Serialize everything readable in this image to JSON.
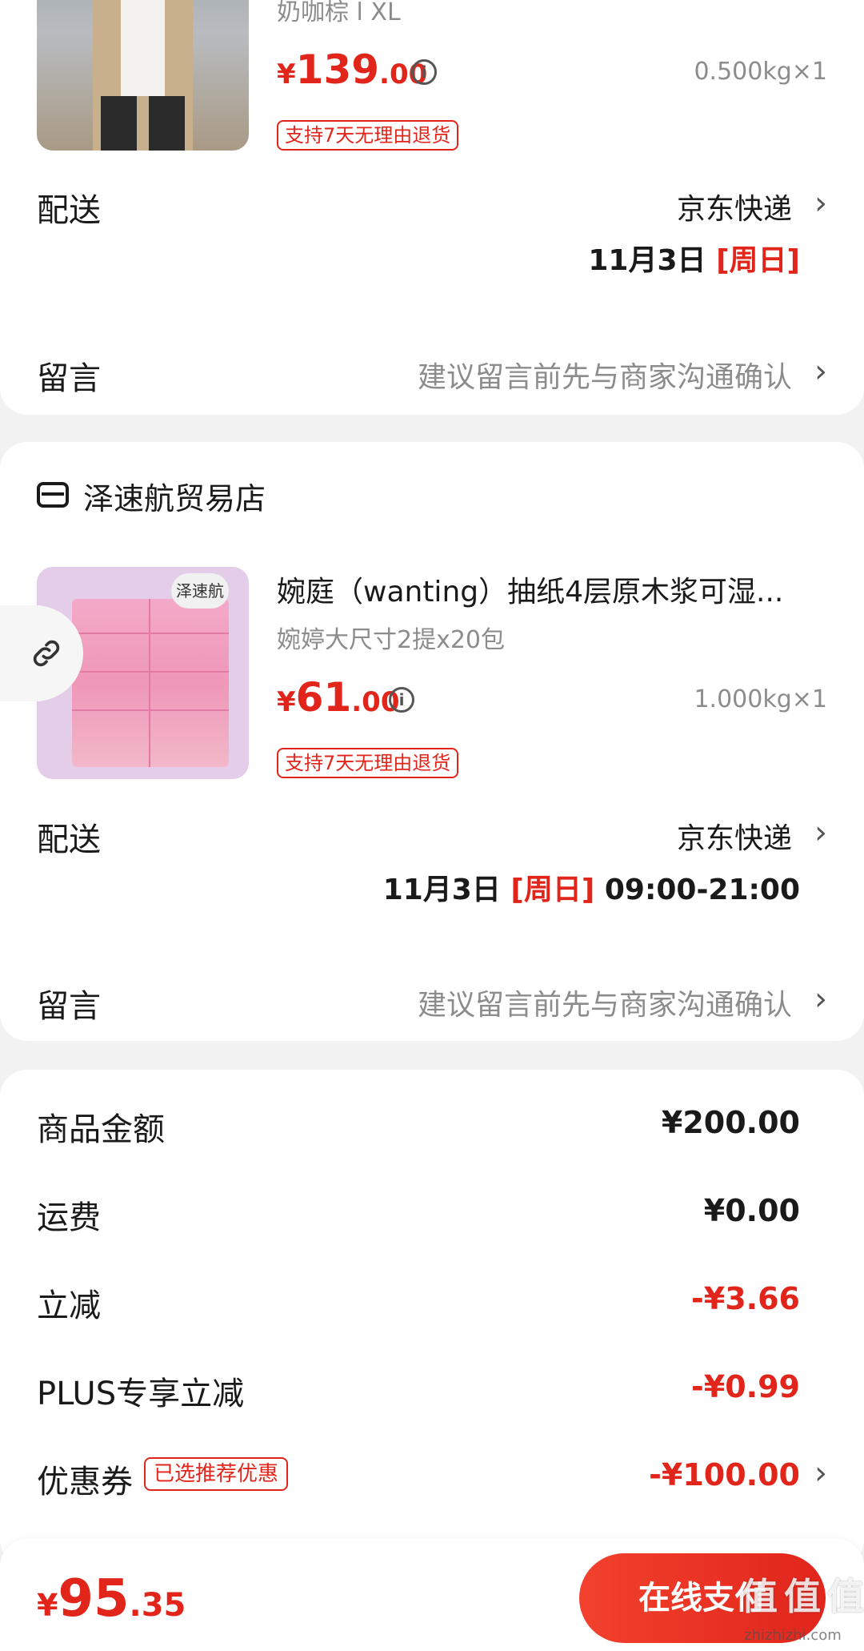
{
  "colors": {
    "accent": "#e1251b",
    "background": "#f2f2f2"
  },
  "item1": {
    "variant": "奶咖棕 l XL",
    "price_currency": "¥",
    "price_int": "139",
    "price_dec": ".00",
    "weight": "0.500kg×1",
    "return_tag": "支持7天无理由退货",
    "delivery_label": "配送",
    "delivery_carrier": "京东快递",
    "delivery_date": "11月3日",
    "delivery_weekday": "[周日]",
    "message_label": "留言",
    "message_placeholder": "建议留言前先与商家沟通确认"
  },
  "shop2": {
    "name": "泽速航贸易店",
    "icon": "store-icon",
    "product_title": "婉庭（wanting）抽纸4层原木浆可湿...",
    "variant": "婉婷大尺寸2提x20包",
    "price_currency": "¥",
    "price_int": "61",
    "price_dec": ".00",
    "weight": "1.000kg×1",
    "return_tag": "支持7天无理由退货",
    "delivery_label": "配送",
    "delivery_carrier": "京东快递",
    "delivery_date": "11月3日",
    "delivery_weekday": "[周日]",
    "delivery_time": "09:00-21:00",
    "message_label": "留言",
    "message_placeholder": "建议留言前先与商家沟通确认",
    "product_image_text": "泽速航"
  },
  "summary": {
    "goods_label": "商品金额",
    "goods_value": "¥200.00",
    "shipping_label": "运费",
    "shipping_value": "¥0.00",
    "discount_label": "立减",
    "discount_value": "-¥3.66",
    "plus_label": "PLUS专享立减",
    "plus_value": "-¥0.99",
    "coupon_label": "优惠券",
    "coupon_badge": "已选推荐优惠",
    "coupon_value": "-¥100.00"
  },
  "footer": {
    "total_currency": "¥",
    "total_int": "95",
    "total_dec": ".35",
    "pay_button": "在线支付",
    "watermark": "值 值 值",
    "watermark_url": "zhizhizhi.com"
  }
}
